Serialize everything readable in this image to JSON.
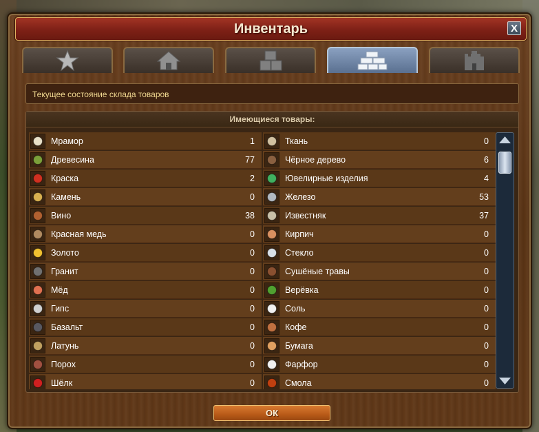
{
  "window": {
    "title": "Инвентарь",
    "close_label": "X"
  },
  "tabs": [
    {
      "icon": "star-icon"
    },
    {
      "icon": "house-icon"
    },
    {
      "icon": "crates-icon"
    },
    {
      "icon": "goods-bricks-icon",
      "active": true
    },
    {
      "icon": "castle-icon"
    }
  ],
  "description": "Текущее состояние склада товаров",
  "panel": {
    "header": "Имеющиеся товары:"
  },
  "left_goods": [
    {
      "name": "Мрамор",
      "qty": "1",
      "icon": "marble-icon",
      "color": "#e8e0c8"
    },
    {
      "name": "Древесина",
      "qty": "77",
      "icon": "lumber-icon",
      "color": "#7ba03a"
    },
    {
      "name": "Краска",
      "qty": "2",
      "icon": "dye-icon",
      "color": "#d03020"
    },
    {
      "name": "Камень",
      "qty": "0",
      "icon": "stone-icon",
      "color": "#d8b050"
    },
    {
      "name": "Вино",
      "qty": "38",
      "icon": "wine-icon",
      "color": "#b06030"
    },
    {
      "name": "Красная медь",
      "qty": "0",
      "icon": "copper-icon",
      "color": "#b08a60"
    },
    {
      "name": "Золото",
      "qty": "0",
      "icon": "gold-icon",
      "color": "#f0c030"
    },
    {
      "name": "Гранит",
      "qty": "0",
      "icon": "granite-icon",
      "color": "#707070"
    },
    {
      "name": "Мёд",
      "qty": "0",
      "icon": "honey-icon",
      "color": "#e07050"
    },
    {
      "name": "Гипс",
      "qty": "0",
      "icon": "gypsum-icon",
      "color": "#d0d0d0"
    },
    {
      "name": "Базальт",
      "qty": "0",
      "icon": "basalt-icon",
      "color": "#585860"
    },
    {
      "name": "Латунь",
      "qty": "0",
      "icon": "brass-icon",
      "color": "#c0a060"
    },
    {
      "name": "Порох",
      "qty": "0",
      "icon": "gunpowder-icon",
      "color": "#a05040"
    },
    {
      "name": "Шёлк",
      "qty": "0",
      "icon": "silk-icon",
      "color": "#d02020"
    }
  ],
  "right_goods": [
    {
      "name": "Ткань",
      "qty": "0",
      "icon": "cloth-icon",
      "color": "#d0c0a0"
    },
    {
      "name": "Чёрное дерево",
      "qty": "6",
      "icon": "ebony-icon",
      "color": "#8a6040"
    },
    {
      "name": "Ювелирные изделия",
      "qty": "4",
      "icon": "jewelry-icon",
      "color": "#40b060"
    },
    {
      "name": "Железо",
      "qty": "53",
      "icon": "iron-icon",
      "color": "#b0b8c0"
    },
    {
      "name": "Известняк",
      "qty": "37",
      "icon": "limestone-icon",
      "color": "#c8c0a8"
    },
    {
      "name": "Кирпич",
      "qty": "0",
      "icon": "brick-icon",
      "color": "#d89060"
    },
    {
      "name": "Стекло",
      "qty": "0",
      "icon": "glass-icon",
      "color": "#d8e0e8"
    },
    {
      "name": "Сушёные травы",
      "qty": "0",
      "icon": "herbs-icon",
      "color": "#8a5030"
    },
    {
      "name": "Верёвка",
      "qty": "0",
      "icon": "rope-icon",
      "color": "#50a030"
    },
    {
      "name": "Соль",
      "qty": "0",
      "icon": "salt-icon",
      "color": "#f0f0f0"
    },
    {
      "name": "Кофе",
      "qty": "0",
      "icon": "coffee-icon",
      "color": "#c07040"
    },
    {
      "name": "Бумага",
      "qty": "0",
      "icon": "paper-icon",
      "color": "#e0a060"
    },
    {
      "name": "Фарфор",
      "qty": "0",
      "icon": "porcelain-icon",
      "color": "#f0f0f0"
    },
    {
      "name": "Смола",
      "qty": "0",
      "icon": "resin-icon",
      "color": "#c04010"
    }
  ],
  "buttons": {
    "ok_label": "ОК"
  }
}
